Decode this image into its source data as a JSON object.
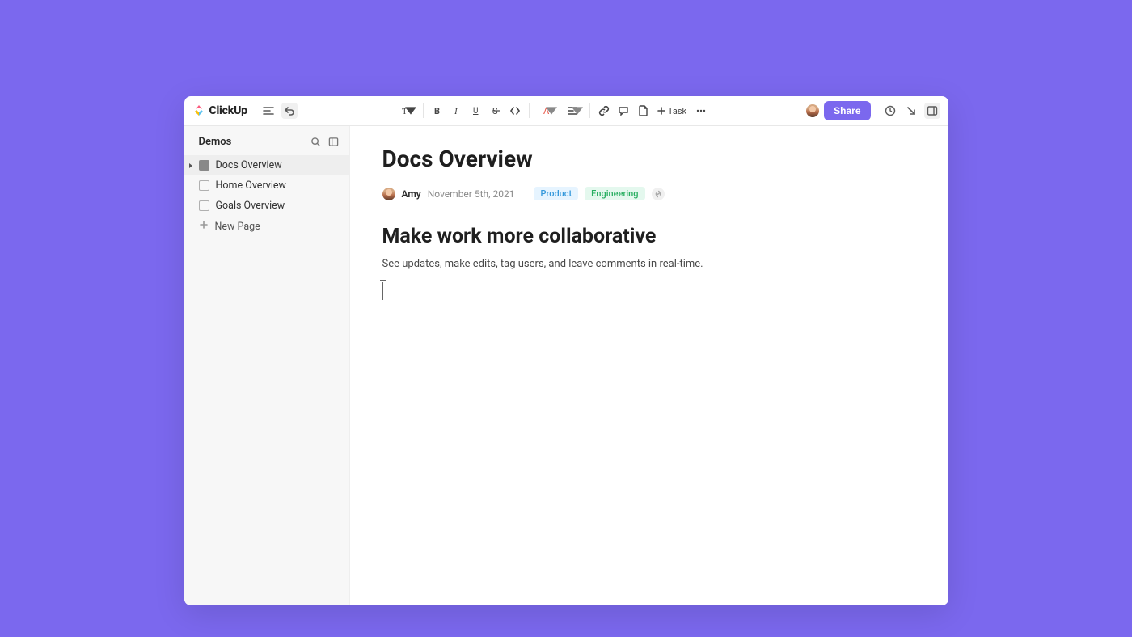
{
  "brand": {
    "name": "ClickUp"
  },
  "toolbar": {
    "task_label": "Task",
    "share_label": "Share"
  },
  "sidebar": {
    "title": "Demos",
    "items": [
      {
        "label": "Docs Overview",
        "active": true
      },
      {
        "label": "Home Overview",
        "active": false
      },
      {
        "label": "Goals Overview",
        "active": false
      }
    ],
    "new_page_label": "New Page"
  },
  "document": {
    "title": "Docs Overview",
    "author": "Amy",
    "date": "November 5th, 2021",
    "tags": [
      {
        "label": "Product",
        "variant": "product"
      },
      {
        "label": "Engineering",
        "variant": "eng"
      }
    ],
    "section_heading": "Make work more collaborative",
    "section_body": "See updates, make edits, tag users, and leave comments in real-time."
  }
}
